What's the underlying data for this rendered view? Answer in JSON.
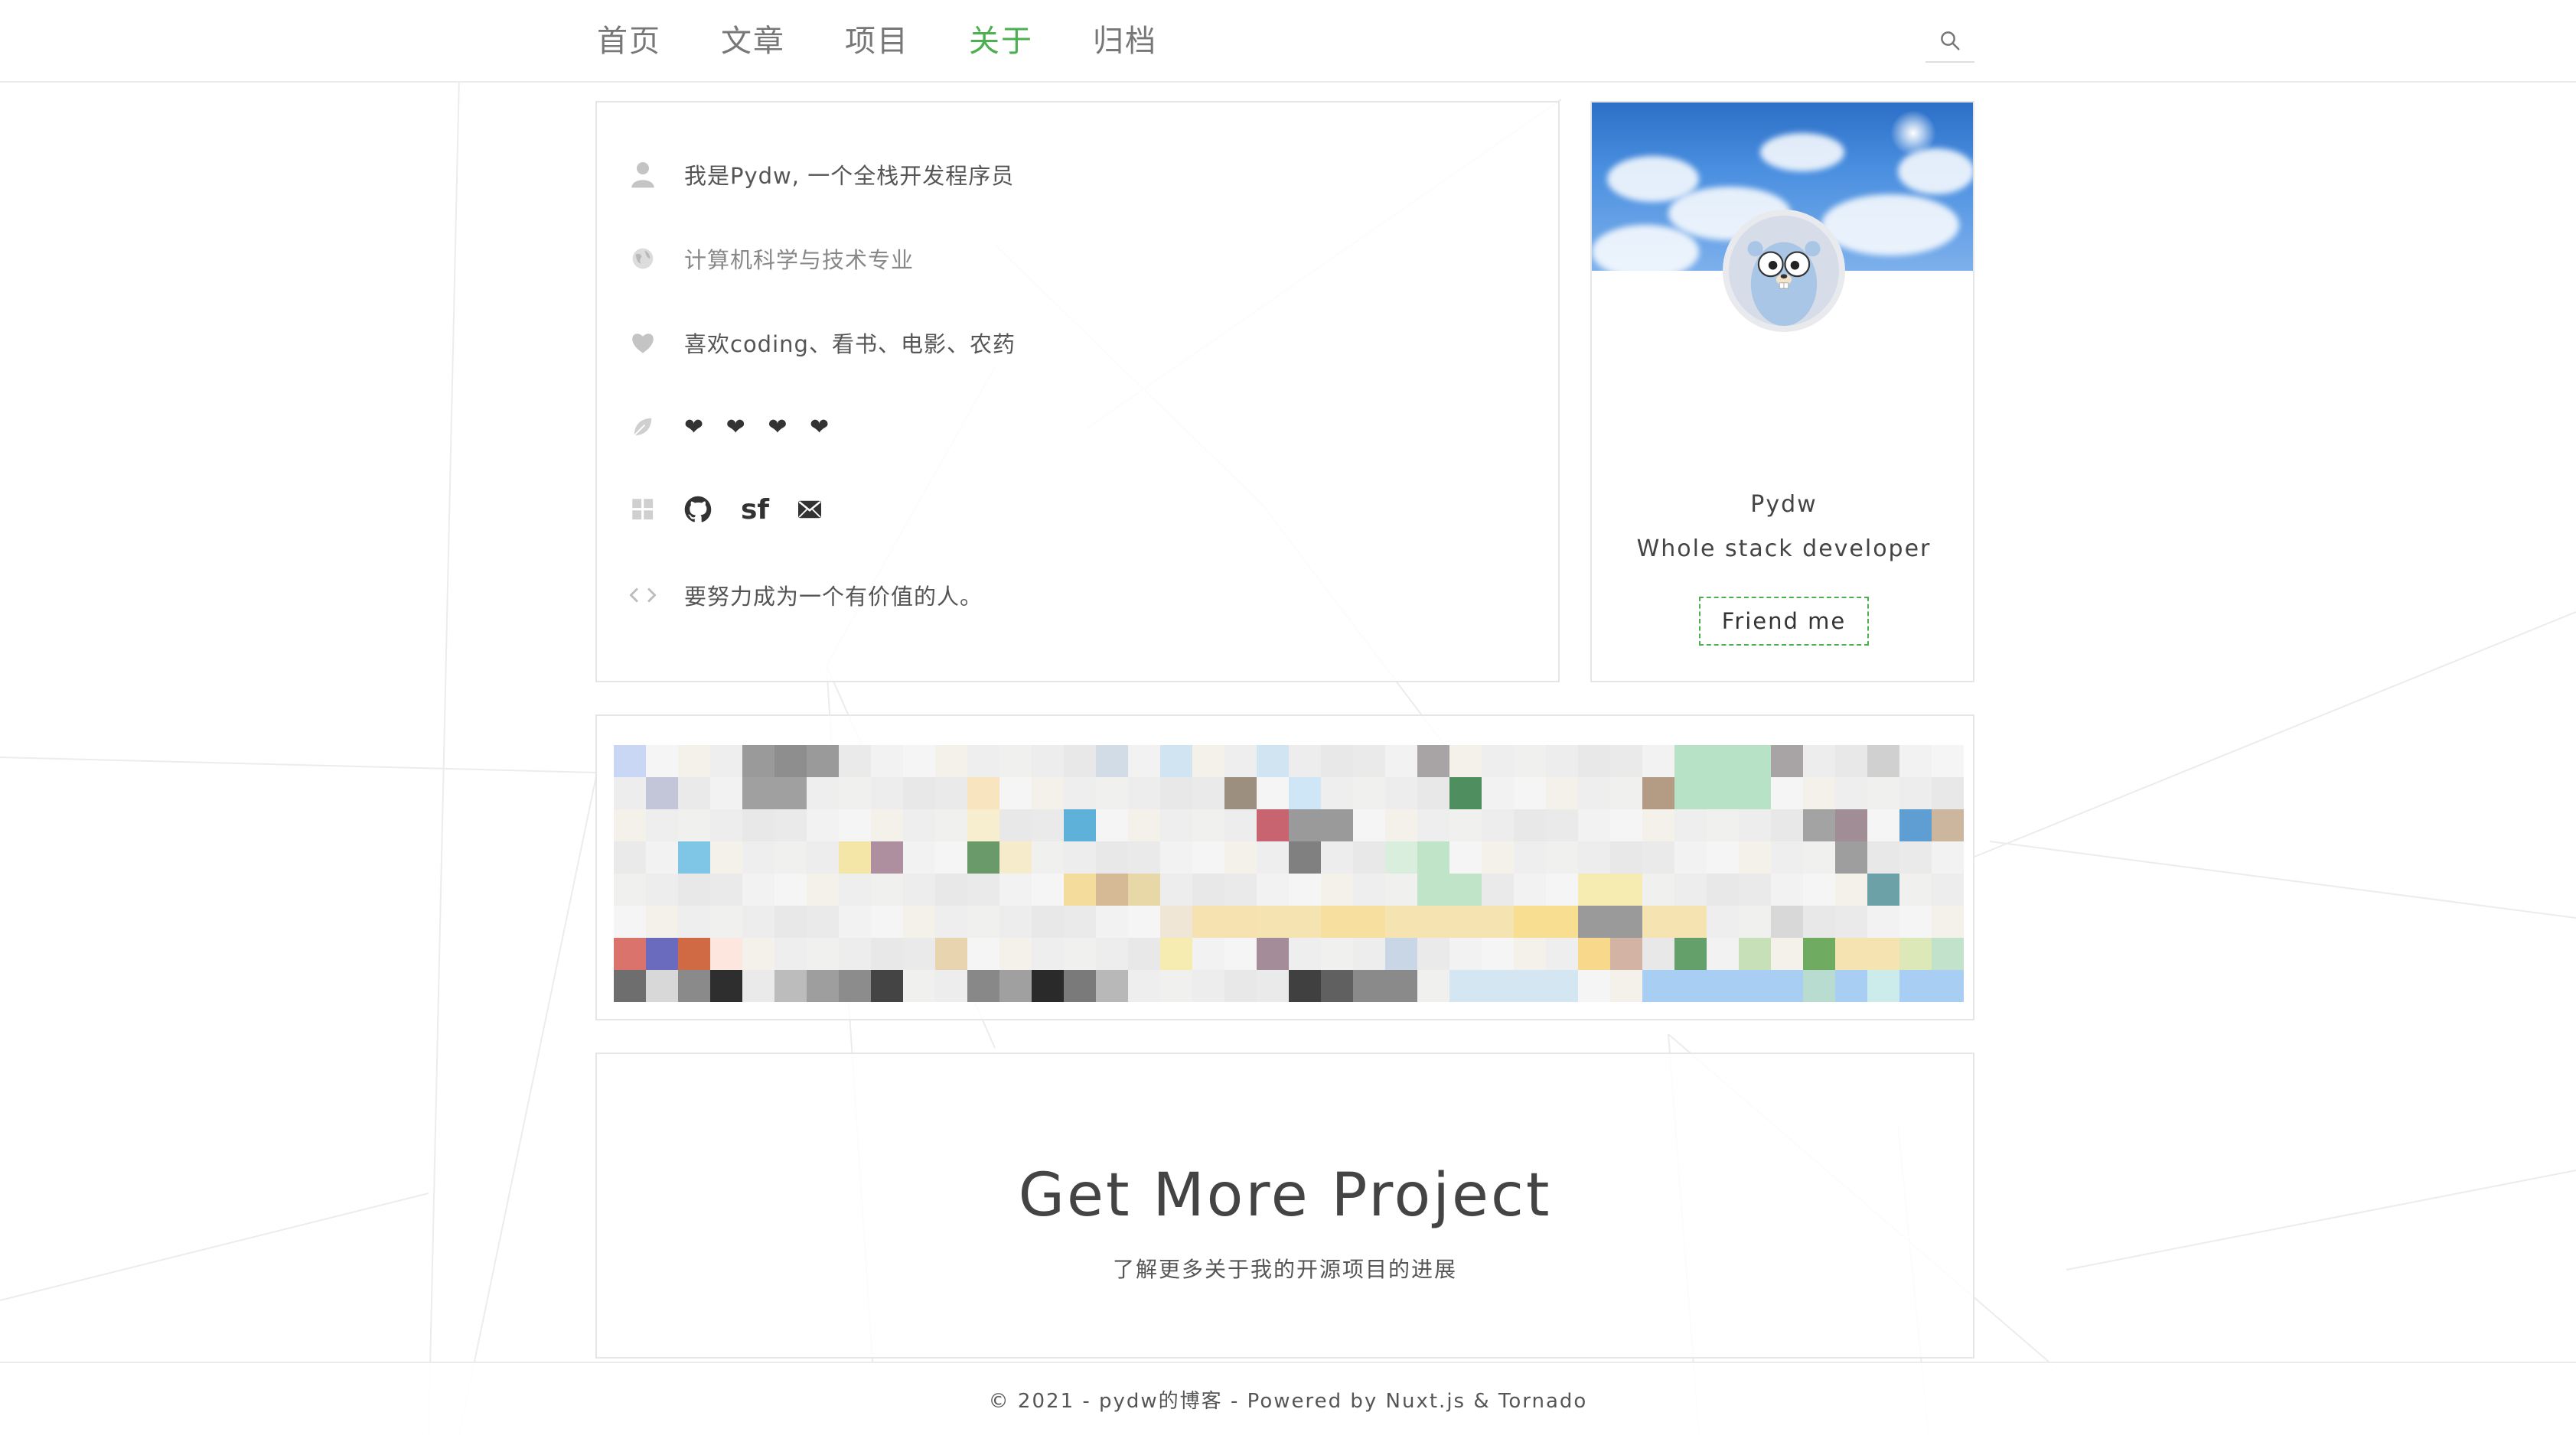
{
  "nav": {
    "items": [
      {
        "label": "首页",
        "active": false
      },
      {
        "label": "文章",
        "active": false
      },
      {
        "label": "项目",
        "active": false
      },
      {
        "label": "关于",
        "active": true
      },
      {
        "label": "归档",
        "active": false
      }
    ],
    "search_icon": "search-icon"
  },
  "about": {
    "intro": "我是Pydw, 一个全栈开发程序员",
    "major": "计算机科学与技术专业",
    "hobbies": "喜欢coding、看书、电影、农药",
    "hearts": "❤ ❤ ❤ ❤",
    "social": {
      "github_icon": "github-icon",
      "sf_label": "sf",
      "mail_icon": "mail-icon"
    },
    "motto": "要努力成为一个有价值的人。"
  },
  "profile": {
    "name": "Pydw",
    "role": "Whole stack developer",
    "friend_button": "Friend me"
  },
  "project": {
    "title": "Get More Project",
    "subtitle": "了解更多关于我的开源项目的进展"
  },
  "footer": {
    "text": "© 2021 - pydw的博客 - Powered by Nuxt.js & Tornado"
  },
  "colors": {
    "accent": "#4caf50",
    "nav_text": "#777777",
    "border": "#e6e6e6"
  }
}
